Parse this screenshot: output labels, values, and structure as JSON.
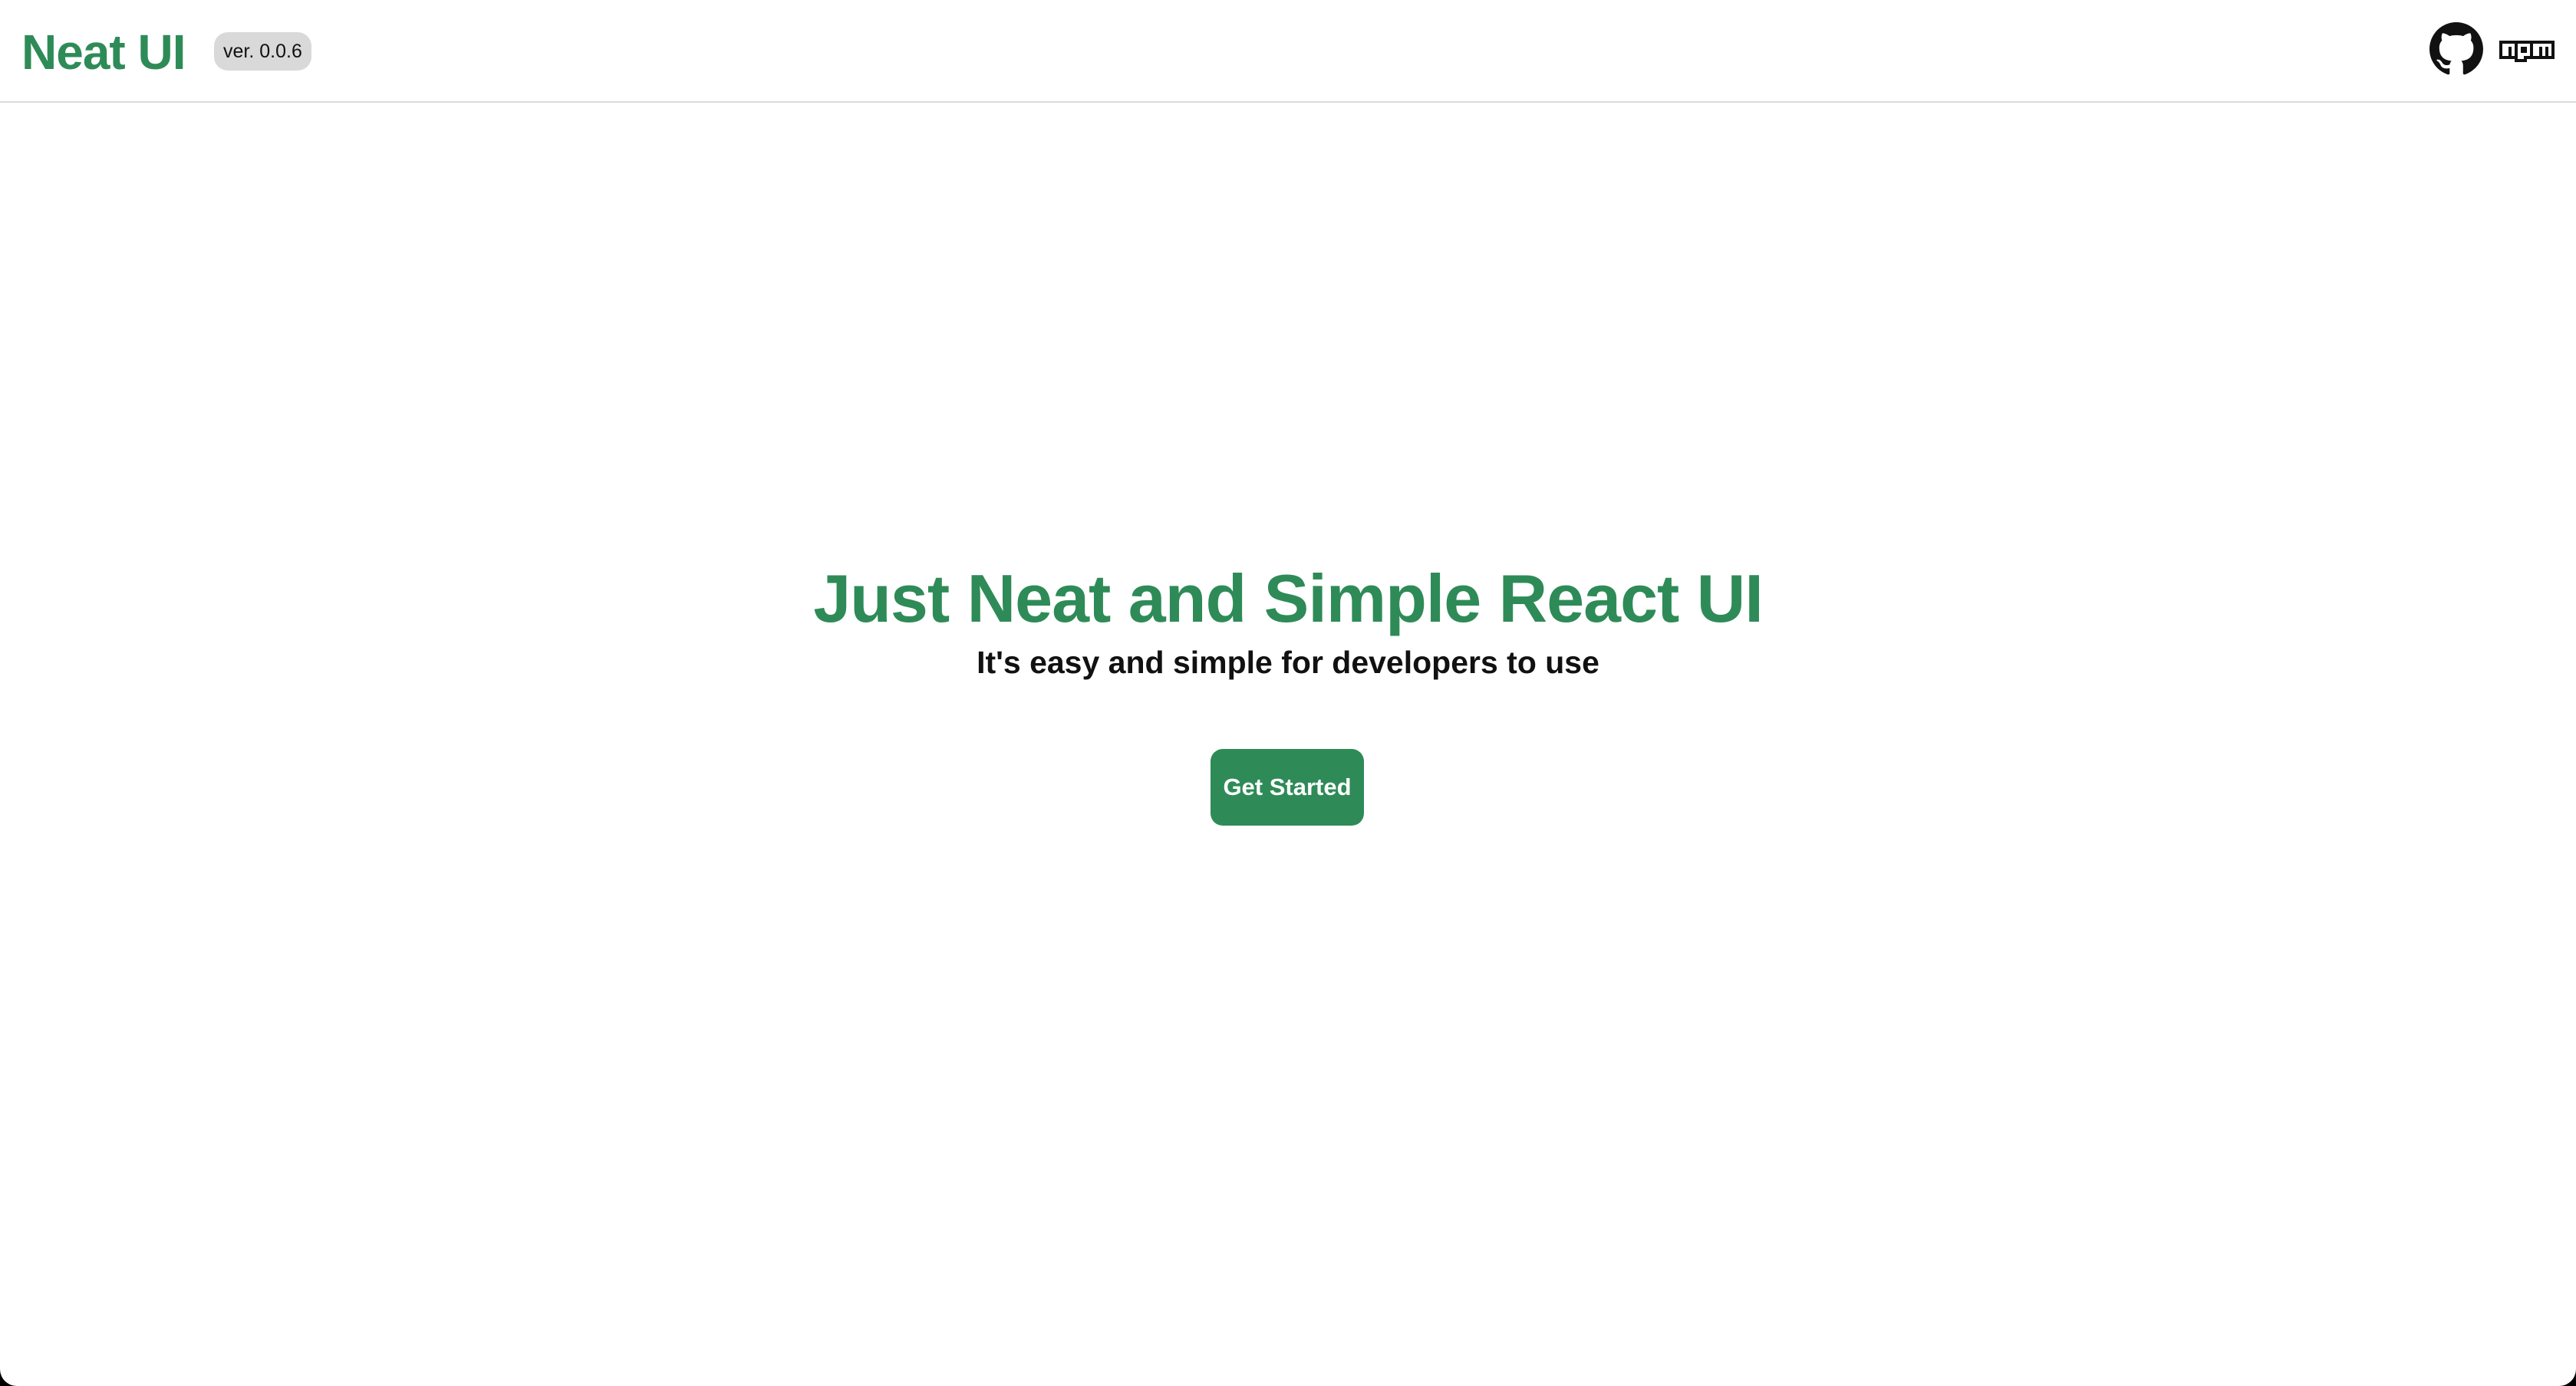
{
  "header": {
    "brand": "Neat UI",
    "version": "ver. 0.0.6",
    "links": [
      {
        "icon": "github-icon"
      },
      {
        "icon": "npm-icon",
        "text": "npm"
      }
    ]
  },
  "hero": {
    "title": "Just Neat and Simple React UI",
    "subtitle": "It's easy and simple for developers to use",
    "cta_label": "Get Started"
  },
  "colors": {
    "brand": "#2e8b57",
    "badge_background": "#d9d9d9",
    "text": "#111111",
    "background": "#ffffff"
  }
}
